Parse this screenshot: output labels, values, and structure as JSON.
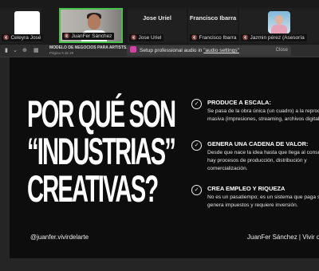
{
  "gallery": {
    "participants": [
      {
        "name": "",
        "tag": "Celeyra José",
        "muted": true
      },
      {
        "name": "",
        "tag": "JuanFer Sánchez",
        "muted": true,
        "speaking": true
      },
      {
        "name": "Jose Uriel",
        "tag": "Jose Uriel",
        "muted": true
      },
      {
        "name": "Francisco Ibarra",
        "tag": "Francisco Ibarra",
        "muted": true
      },
      {
        "name": "",
        "tag": "Jazmin pérez (Asesoría",
        "muted": true
      }
    ]
  },
  "viewer": {
    "doc_title": "MODELO DE NEGOCIOS PARA ARTISTS.pdf",
    "doc_subtitle": "Página 9 de 29",
    "notice_text": "Setup professional audio in ",
    "notice_link": "\"audio settings\"",
    "notice_close": "Close"
  },
  "slide": {
    "title_lines": [
      "POR QUÉ SON",
      "“INDUSTRIAS”",
      "CREATIVAS?"
    ],
    "items": [
      {
        "heading": "PRODUCE A ESCALA:",
        "lines": [
          "Se pasa de la obra única (un cuadro) a la reproducción",
          "masiva (impresiones, streaming, archivos digitales)."
        ]
      },
      {
        "heading": "GENERA UNA CADENA DE VALOR:",
        "lines": [
          "Desde que nace la idea hasta que llega al consumidor,",
          "hay procesos de producción, distribución y",
          "comercialización."
        ]
      },
      {
        "heading": "CREA EMPLEO Y RIQUEZA",
        "lines": [
          "No es un pasatiempo; es un sistema que paga salarios,",
          "genera impuestos y requiere inversión."
        ]
      }
    ],
    "handle": "@juanfer.vivirdelarte",
    "author": "JuanFer Sánchez | Vivir del Arte"
  },
  "icons": {
    "mic_muted": "mic-off-icon",
    "check": "check-circle-icon",
    "audio": "audio-icon"
  }
}
